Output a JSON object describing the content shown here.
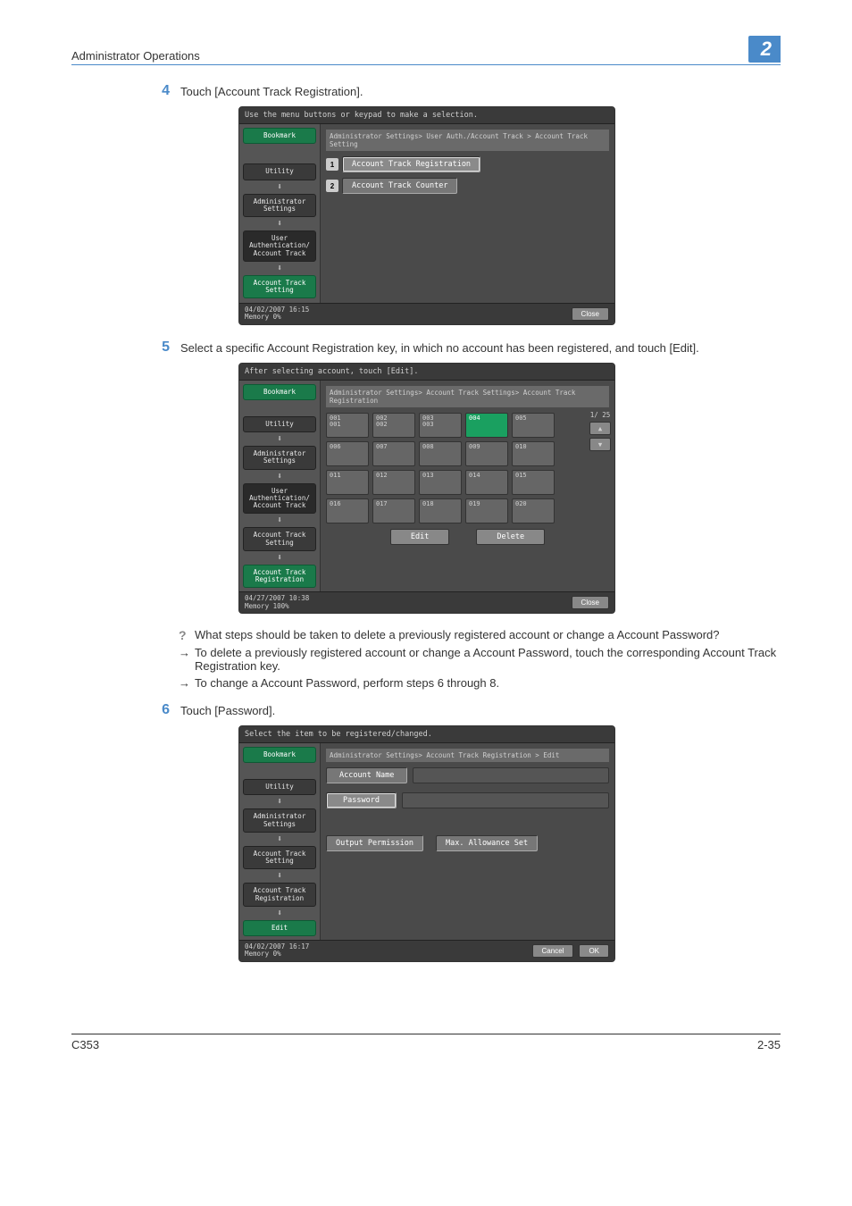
{
  "header": {
    "title": "Administrator Operations",
    "section": "2"
  },
  "step4": {
    "num": "4",
    "text": "Touch [Account Track Registration]."
  },
  "step5": {
    "num": "5",
    "text": "Select a specific Account Registration key, in which no account has been registered, and touch [Edit]."
  },
  "step6": {
    "num": "6",
    "text": "Touch [Password]."
  },
  "notes": {
    "q": "What steps should be taken to delete a previously registered account or change a Account Password?",
    "a1": "To delete a previously registered account or change a Account Password, touch the corresponding Account Track Registration key.",
    "a2": "To change a Account Password, perform steps 6 through 8."
  },
  "screen1": {
    "topmsg": "Use the menu buttons or keypad to make a selection.",
    "breadcrumb": "Administrator Settings> User Auth./Account Track > Account Track Setting",
    "side": {
      "bookmark": "Bookmark",
      "utility": "Utility",
      "admin": "Administrator Settings",
      "userauth": "User Authentication/ Account Track",
      "atsetting": "Account Track Setting"
    },
    "menu1_num": "1",
    "menu1": "Account Track Registration",
    "menu2_num": "2",
    "menu2": "Account Track Counter",
    "foot_date": "04/02/2007   16:15",
    "foot_mem": "Memory         0%",
    "close": "Close"
  },
  "screen2": {
    "topmsg": "After selecting account, touch [Edit].",
    "breadcrumb": "Administrator Settings> Account Track Settings> Account Track Registration",
    "side": {
      "bookmark": "Bookmark",
      "utility": "Utility",
      "admin": "Administrator Settings",
      "userauth": "User Authentication/ Account Track",
      "atsetting": "Account Track Setting",
      "atreg": "Account Track Registration"
    },
    "page": "1/ 25",
    "cells": [
      {
        "id": "001",
        "sub": "001"
      },
      {
        "id": "002",
        "sub": "002"
      },
      {
        "id": "003",
        "sub": "003"
      },
      {
        "id": "004",
        "sub": ""
      },
      {
        "id": "005",
        "sub": ""
      },
      {
        "id": "006",
        "sub": ""
      },
      {
        "id": "007",
        "sub": ""
      },
      {
        "id": "008",
        "sub": ""
      },
      {
        "id": "009",
        "sub": ""
      },
      {
        "id": "010",
        "sub": ""
      },
      {
        "id": "011",
        "sub": ""
      },
      {
        "id": "012",
        "sub": ""
      },
      {
        "id": "013",
        "sub": ""
      },
      {
        "id": "014",
        "sub": ""
      },
      {
        "id": "015",
        "sub": ""
      },
      {
        "id": "016",
        "sub": ""
      },
      {
        "id": "017",
        "sub": ""
      },
      {
        "id": "018",
        "sub": ""
      },
      {
        "id": "019",
        "sub": ""
      },
      {
        "id": "020",
        "sub": ""
      }
    ],
    "edit": "Edit",
    "delete": "Delete",
    "foot_date": "04/27/2007   10:38",
    "foot_mem": "Memory       100%",
    "close": "Close"
  },
  "screen3": {
    "topmsg": "Select the item to be registered/changed.",
    "breadcrumb": "Administrator Settings> Account Track Registration > Edit",
    "side": {
      "bookmark": "Bookmark",
      "utility": "Utility",
      "admin": "Administrator Settings",
      "atsetting": "Account Track Setting",
      "atreg": "Account Track Registration",
      "edit": "Edit"
    },
    "acctname": "Account Name",
    "password": "Password",
    "output": "Output Permission",
    "maxallow": "Max. Allowance Set",
    "foot_date": "04/02/2007   16:17",
    "foot_mem": "Memory         0%",
    "cancel": "Cancel",
    "ok": "OK"
  },
  "footer": {
    "left": "C353",
    "right": "2-35"
  }
}
